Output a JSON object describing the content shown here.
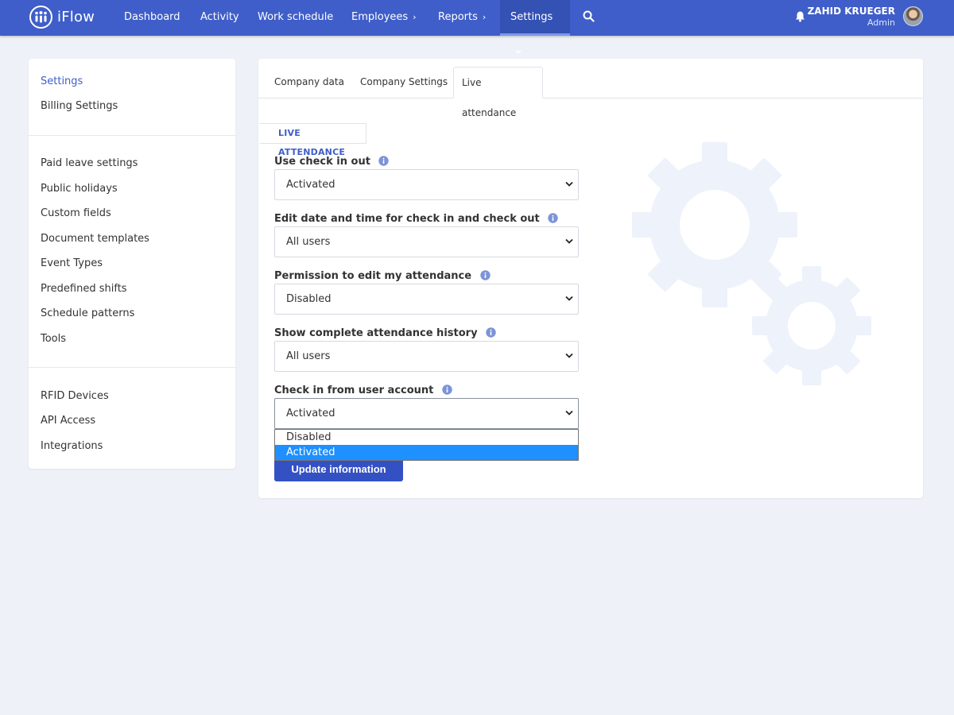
{
  "app": {
    "logo_text": "iFlow"
  },
  "nav": {
    "items": [
      {
        "label": "Dashboard"
      },
      {
        "label": "Activity"
      },
      {
        "label": "Work schedule"
      },
      {
        "label": "Employees"
      },
      {
        "label": "Reports"
      },
      {
        "label": "Settings"
      }
    ],
    "search_icon": "search-icon",
    "bell_icon": "bell-icon"
  },
  "user": {
    "name": "ZAHID KRUEGER",
    "role": "Admin"
  },
  "sidebar": {
    "groups": [
      [
        {
          "label": "Settings",
          "active": true
        },
        {
          "label": "Billing Settings"
        }
      ],
      [
        {
          "label": "Paid leave settings"
        },
        {
          "label": "Public holidays"
        },
        {
          "label": "Custom fields"
        },
        {
          "label": "Document templates"
        },
        {
          "label": "Event Types"
        },
        {
          "label": "Predefined shifts"
        },
        {
          "label": "Schedule patterns"
        },
        {
          "label": "Tools"
        }
      ],
      [
        {
          "label": "RFID Devices"
        },
        {
          "label": "API Access"
        },
        {
          "label": "Integrations"
        }
      ]
    ]
  },
  "tabs": [
    {
      "label": "Company data"
    },
    {
      "label": "Company Settings"
    },
    {
      "label": "Live attendance",
      "active": true
    }
  ],
  "section": {
    "label": "LIVE ATTENDANCE"
  },
  "fields": [
    {
      "label": "Use check in out",
      "value": "Activated"
    },
    {
      "label": "Edit date and time for check in and check out",
      "value": "All users"
    },
    {
      "label": "Permission to edit my attendance",
      "value": "Disabled"
    },
    {
      "label": "Show complete attendance history",
      "value": "All users"
    },
    {
      "label": "Check in from user account",
      "value": "Activated"
    }
  ],
  "dropdown": {
    "options": [
      {
        "label": "Disabled"
      },
      {
        "label": "Activated",
        "selected": true
      }
    ]
  },
  "actions": {
    "update_label": "Update information"
  },
  "colors": {
    "primary": "#3f5ec9",
    "nav_bg": "#3f5ec9",
    "selected_option": "#1e90ff",
    "page_bg": "#eef1f7"
  }
}
